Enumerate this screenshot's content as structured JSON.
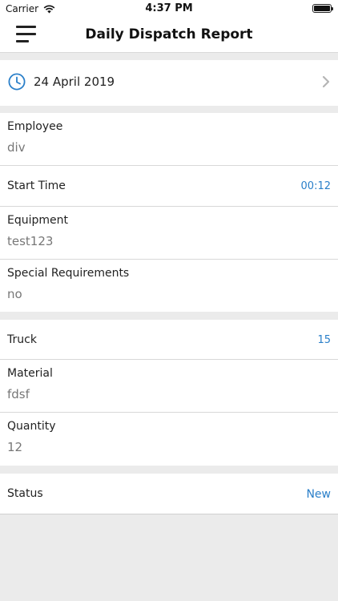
{
  "status_bar": {
    "carrier": "Carrier",
    "time": "4:37 PM"
  },
  "nav": {
    "title": "Daily Dispatch Report"
  },
  "date": {
    "value": "24 April 2019"
  },
  "fields": {
    "employee": {
      "label": "Employee",
      "value": "div"
    },
    "start_time": {
      "label": "Start Time",
      "value": "00:12"
    },
    "equipment": {
      "label": "Equipment",
      "value": "test123"
    },
    "special_requirements": {
      "label": "Special Requirements",
      "value": "no"
    },
    "truck": {
      "label": "Truck",
      "value": "15"
    },
    "material": {
      "label": "Material",
      "value": "fdsf"
    },
    "quantity": {
      "label": "Quantity",
      "value": "12"
    },
    "status": {
      "label": "Status",
      "value": "New"
    }
  },
  "colors": {
    "accent": "#2a7fc9",
    "background": "#ebebeb",
    "cell": "#ffffff",
    "separator": "#d8d8d8"
  },
  "icons": {
    "menu": "hamburger-menu-icon",
    "date": "clock-icon",
    "disclosure": "chevron-right-icon",
    "wifi": "wifi-icon",
    "battery": "battery-icon"
  }
}
